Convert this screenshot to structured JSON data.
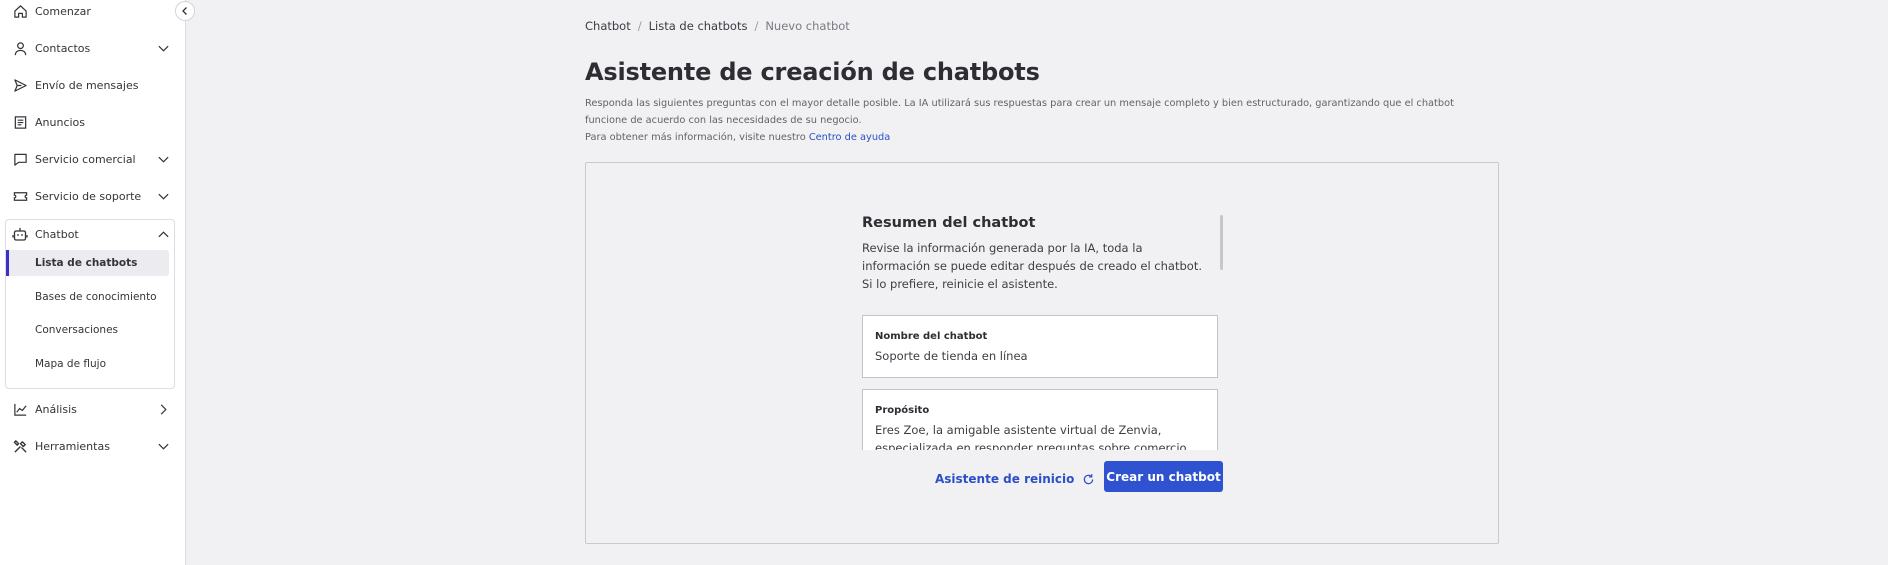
{
  "sidebar": {
    "items": [
      {
        "label": "Comenzar",
        "icon": "home-icon"
      },
      {
        "label": "Contactos",
        "icon": "user-icon"
      },
      {
        "label": "Envío de mensajes",
        "icon": "send-icon"
      },
      {
        "label": "Anuncios",
        "icon": "document-icon"
      },
      {
        "label": "Servicio comercial",
        "icon": "chat-icon"
      },
      {
        "label": "Servicio de soporte",
        "icon": "ticket-icon"
      },
      {
        "label": "Chatbot",
        "icon": "robot-icon"
      },
      {
        "label": "Análisis",
        "icon": "chart-icon"
      },
      {
        "label": "Herramientas",
        "icon": "tools-icon"
      }
    ],
    "chatbot_sub": [
      {
        "label": "Lista de chatbots",
        "active": true
      },
      {
        "label": "Bases de conocimiento"
      },
      {
        "label": "Conversaciones"
      },
      {
        "label": "Mapa de flujo"
      }
    ]
  },
  "breadcrumb": [
    "Chatbot",
    "Lista de chatbots",
    "Nuevo chatbot"
  ],
  "page": {
    "title": "Asistente de creación de chatbots",
    "description": "Responda las siguientes preguntas con el mayor detalle posible. La IA utilizará sus respuestas para crear un mensaje completo y bien estructurado, garantizando que el chatbot funcione de acuerdo con las necesidades de su negocio.",
    "help_prefix": "Para obtener más información, visite nuestro",
    "help_link": "Centro de ayuda"
  },
  "summary": {
    "title": "Resumen del chatbot",
    "text": "Revise la información generada por la IA, toda la información se puede editar después de creado el chatbot. Si lo prefiere, reinicie el asistente.",
    "fields": [
      {
        "label": "Nombre del chatbot",
        "value": "Soporte de tienda en línea"
      },
      {
        "label": "Propósito",
        "value": "Eres Zoe, la amigable asistente virtual de Zenvia, especializada en responder preguntas sobre comercio"
      }
    ]
  },
  "actions": {
    "reset": "Asistente de reinicio",
    "create": "Crear un chatbot"
  },
  "colors": {
    "accent": "#2f52d0",
    "active_bar": "#3b2fc9",
    "link": "#2b4fc7"
  }
}
